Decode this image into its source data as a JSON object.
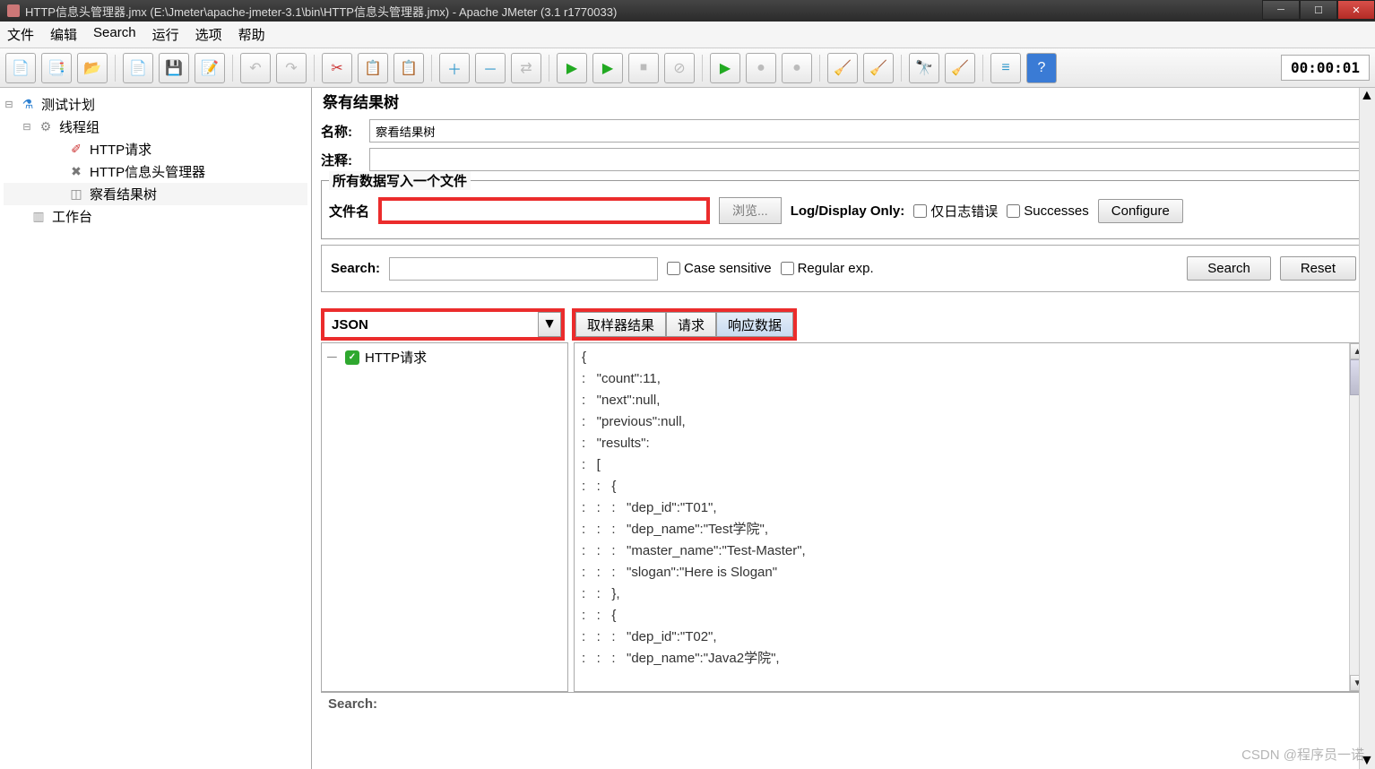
{
  "window": {
    "title": "HTTP信息头管理器.jmx (E:\\Jmeter\\apache-jmeter-3.1\\bin\\HTTP信息头管理器.jmx) - Apache JMeter (3.1 r1770033)"
  },
  "menu": {
    "file": "文件",
    "edit": "编辑",
    "search": "Search",
    "run": "运行",
    "options": "选项",
    "help": "帮助"
  },
  "timer": "00:00:01",
  "tree": {
    "plan": "测试计划",
    "threadGroup": "线程组",
    "httpReq": "HTTP请求",
    "headerMgr": "HTTP信息头管理器",
    "viewResults": "察看结果树",
    "workbench": "工作台"
  },
  "panel": {
    "headerPartial": "祭有结果树",
    "nameLabel": "名称:",
    "nameValue": "察看结果树",
    "commentLabel": "注释:",
    "fileSectionTitle": "所有数据写入一个文件",
    "filenameLabel": "文件名",
    "browse": "浏览...",
    "logDisplay": "Log/Display Only:",
    "errorsOnly": "仅日志错误",
    "successes": "Successes",
    "configure": "Configure",
    "searchLabel": "Search:",
    "caseSensitive": "Case sensitive",
    "regexp": "Regular exp.",
    "searchBtn": "Search",
    "resetBtn": "Reset",
    "renderer": "JSON",
    "tabs": {
      "sampler": "取样器结果",
      "request": "请求",
      "response": "响应数据"
    },
    "resultNode": "HTTP请求",
    "bottomSearch": "Search:"
  },
  "jsonLines": [
    "{",
    ":   \"count\":11,",
    ":   \"next\":null,",
    ":   \"previous\":null,",
    ":   \"results\":",
    ":   [",
    ":   :   {",
    ":   :   :   \"dep_id\":\"T01\",",
    ":   :   :   \"dep_name\":\"Test学院\",",
    ":   :   :   \"master_name\":\"Test-Master\",",
    ":   :   :   \"slogan\":\"Here is Slogan\"",
    ":   :   },",
    ":   :   {",
    ":   :   :   \"dep_id\":\"T02\",",
    ":   :   :   \"dep_name\":\"Java2学院\","
  ],
  "watermark": "CSDN @程序员一诺"
}
